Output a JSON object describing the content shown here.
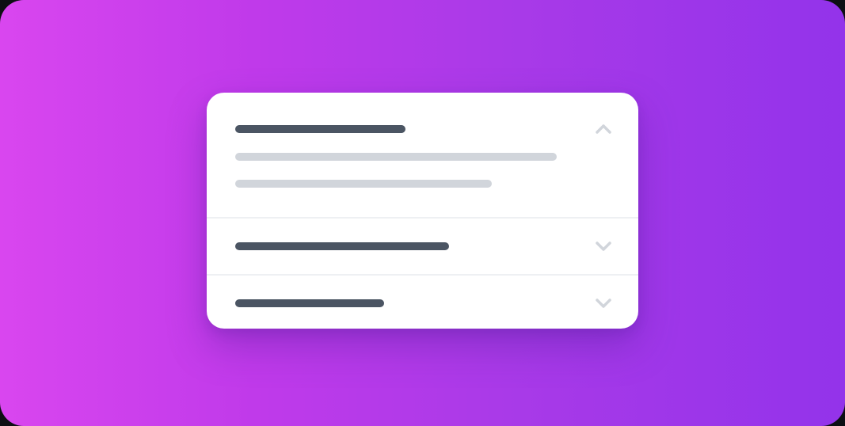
{
  "accordion": {
    "items": [
      {
        "title": "",
        "expanded": true,
        "icon": "chevron-up-icon",
        "body_lines": [
          "",
          ""
        ]
      },
      {
        "title": "",
        "expanded": false,
        "icon": "chevron-down-icon"
      },
      {
        "title": "",
        "expanded": false,
        "icon": "chevron-down-icon"
      }
    ]
  },
  "colors": {
    "background_start": "#d946ef",
    "background_end": "#9333ea",
    "card": "#ffffff",
    "title_placeholder": "#4b5563",
    "body_placeholder": "#d1d5db",
    "chevron": "#d1d5db",
    "divider": "#eef0f3"
  }
}
